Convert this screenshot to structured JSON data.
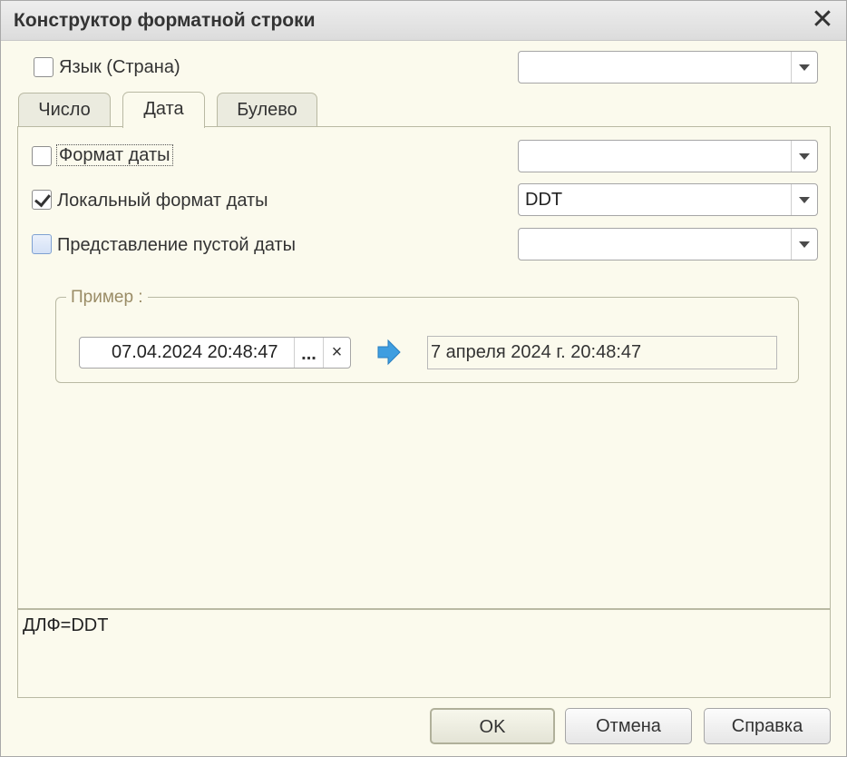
{
  "window": {
    "title": "Конструктор форматной строки"
  },
  "language": {
    "label": "Язык (Страна)",
    "checked": false,
    "value": ""
  },
  "tabs": [
    {
      "label": "Число",
      "active": false
    },
    {
      "label": "Дата",
      "active": true
    },
    {
      "label": "Булево",
      "active": false
    }
  ],
  "date_tab": {
    "date_format": {
      "label": "Формат даты",
      "checked": false,
      "value": ""
    },
    "local_date_format": {
      "label": "Локальный формат даты",
      "checked": true,
      "value": "DDT"
    },
    "empty_date": {
      "label": "Представление пустой даты",
      "checked": false,
      "value": ""
    },
    "example": {
      "title": "Пример :",
      "input_value": "07.04.2024 20:48:47",
      "choice_label": "...",
      "clear_label": "×",
      "result_value": "7 апреля 2024 г. 20:48:47"
    }
  },
  "format_string": "ДЛФ=DDT",
  "buttons": {
    "ok": "OK",
    "cancel": "Отмена",
    "help": "Справка"
  },
  "icons": {
    "close": "close-icon",
    "arrow": "arrow-right-icon",
    "dropdown": "chevron-down-icon"
  },
  "colors": {
    "window_bg": "#fbfaed",
    "arrow": "#3f9ee0",
    "group_title": "#9a8c66"
  }
}
